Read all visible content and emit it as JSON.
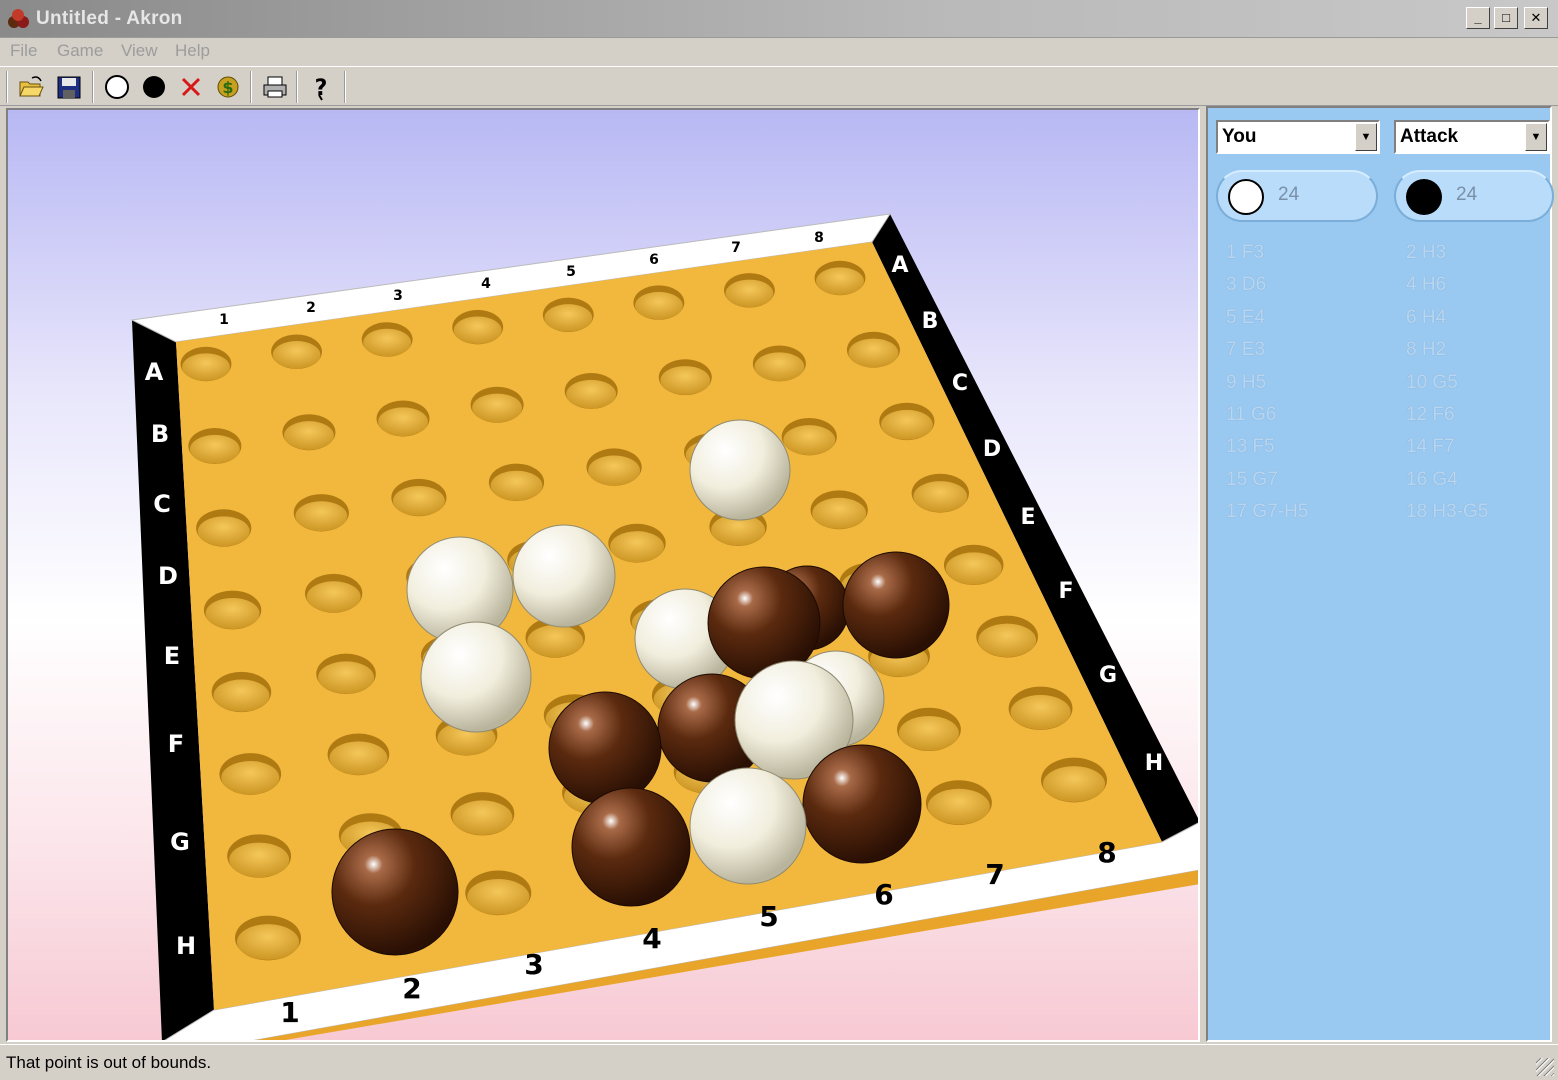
{
  "window": {
    "title": "Untitled - Akron",
    "buttons": {
      "minimize": "_",
      "maximize": "□",
      "close": "✕"
    }
  },
  "menu": [
    "File",
    "Game",
    "View",
    "Help"
  ],
  "toolbar": {
    "buttons": [
      "open-icon",
      "save-icon",
      "white-stone-icon",
      "black-stone-icon",
      "remove-x-icon",
      "money-icon",
      "print-icon",
      "help-icon"
    ]
  },
  "board": {
    "colors": {
      "wood": "#f2b73d",
      "rim": "#ffffff",
      "side": "#000000",
      "white_ball": "#f4f1e2",
      "black_ball": "#5b2a0f"
    },
    "top_numbers": [
      "1",
      "2",
      "3",
      "4",
      "5",
      "6",
      "7",
      "8"
    ],
    "bottom_numbers": [
      "1",
      "2",
      "3",
      "4",
      "5",
      "6",
      "7",
      "8"
    ],
    "left_letters": [
      "A",
      "B",
      "C",
      "D",
      "E",
      "F",
      "G",
      "H"
    ],
    "right_letters": [
      "A",
      "B",
      "C",
      "D",
      "E",
      "F",
      "G",
      "H"
    ]
  },
  "panel": {
    "player_select": "You",
    "mode_select": "Attack",
    "white_score": "24",
    "black_score": "24",
    "moves": [
      [
        "1 F3",
        "2 H3"
      ],
      [
        "3 D6",
        "4 H6"
      ],
      [
        "5 E4",
        "6 H4"
      ],
      [
        "7 E3",
        "8 H2"
      ],
      [
        "9 H5",
        "10 G5"
      ],
      [
        "11 G6",
        "12 F6"
      ],
      [
        "13 F5",
        "14 F7"
      ],
      [
        "15 G7",
        "16 G4"
      ],
      [
        "17 G7-H5",
        "18 H3-G5"
      ]
    ]
  },
  "status": {
    "text": "That point is out of bounds."
  }
}
